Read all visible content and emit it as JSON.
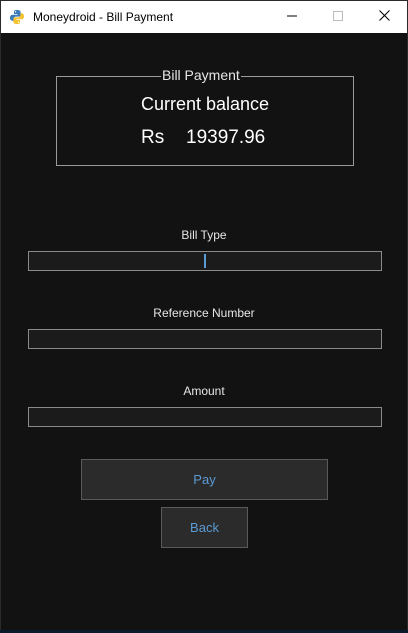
{
  "window": {
    "title": "Moneydroid - Bill Payment",
    "app_icon": "python-icon",
    "controls": {
      "minimize_icon": "minimize-icon",
      "maximize_icon": "maximize-icon",
      "close_icon": "close-icon"
    }
  },
  "balance": {
    "frame_title": "Bill Payment",
    "label": "Current balance",
    "currency": "Rs",
    "amount": "19397.96"
  },
  "form": {
    "bill_type": {
      "label": "Bill Type",
      "value": ""
    },
    "reference_number": {
      "label": "Reference Number",
      "value": ""
    },
    "amount": {
      "label": "Amount",
      "value": ""
    }
  },
  "buttons": {
    "pay": "Pay",
    "back": "Back"
  },
  "colors": {
    "background": "#121212",
    "button_text": "#5b9bd5",
    "caret": "#5b9bd5"
  }
}
